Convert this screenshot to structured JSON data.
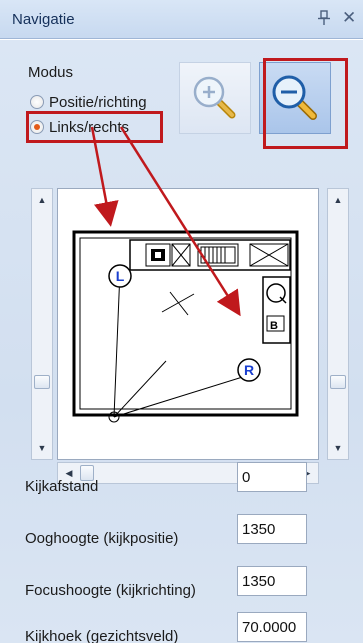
{
  "window": {
    "title": "Navigatie"
  },
  "modus": {
    "label": "Modus",
    "options": [
      {
        "label": "Positie/richting",
        "checked": false
      },
      {
        "label": "Links/rechts",
        "checked": true
      }
    ]
  },
  "zoom": {
    "in_icon": "zoom-in-icon",
    "out_icon": "zoom-out-icon"
  },
  "plan": {
    "marker_left": "L",
    "marker_right": "R"
  },
  "fields": [
    {
      "label": "Kijkafstand",
      "value": "0"
    },
    {
      "label": "Ooghoogte (kijkpositie)",
      "value": "1350"
    },
    {
      "label": "Focushoogte (kijkrichting)",
      "value": "1350"
    },
    {
      "label": "Kijkhoek (gezichtsveld)",
      "value": "70.0000"
    }
  ],
  "colors": {
    "highlight": "#c0191d",
    "title_bar": "#c7d9f0",
    "panel": "#d2dff0"
  }
}
